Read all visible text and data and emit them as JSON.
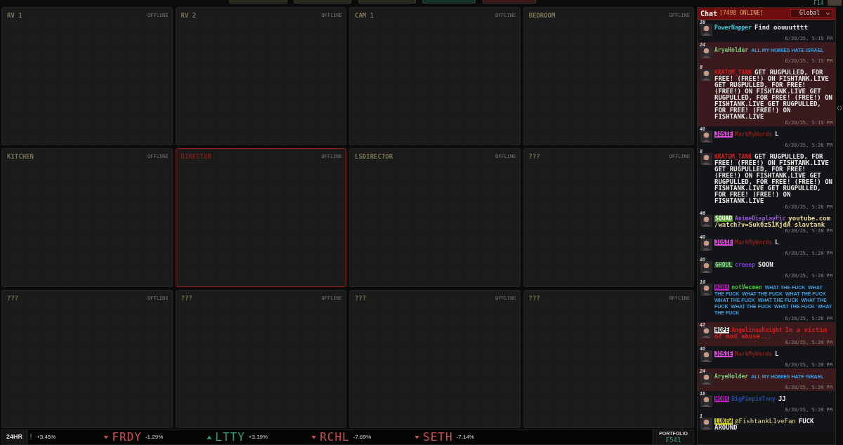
{
  "top_buttons": [
    {
      "color": "#2a271c"
    },
    {
      "color": "#2a271c"
    },
    {
      "color": "#2a271c"
    },
    {
      "color": "#16302c"
    },
    {
      "color": "#3a1616"
    }
  ],
  "account": {
    "balance": "₣14"
  },
  "cameras": [
    {
      "name": "RV 1",
      "status": "OFFLINE",
      "selected": false
    },
    {
      "name": "RV 2",
      "status": "OFFLINE",
      "selected": false
    },
    {
      "name": "CAM 1",
      "status": "OFFLINE",
      "selected": false
    },
    {
      "name": "BEDROOM",
      "status": "OFFLINE",
      "selected": false
    },
    {
      "name": "KITCHEN",
      "status": "OFFLINE",
      "selected": false
    },
    {
      "name": "DIRECTOR",
      "status": "OFFLINE",
      "selected": true
    },
    {
      "name": "LSDIRECTOR",
      "status": "OFFLINE",
      "selected": false
    },
    {
      "name": "???",
      "status": "OFFLINE",
      "selected": false
    },
    {
      "name": "???",
      "status": "OFFLINE",
      "selected": false
    },
    {
      "name": "???",
      "status": "OFFLINE",
      "selected": false
    },
    {
      "name": "???",
      "status": "OFFLINE",
      "selected": false
    },
    {
      "name": "???",
      "status": "OFFLINE",
      "selected": false
    }
  ],
  "chat": {
    "title": "Chat",
    "online": "[7498 ONLINE]",
    "room": "Global",
    "messages": [
      {
        "level": "39",
        "user": {
          "name": "PowerNapper",
          "color": "#3fc8d8"
        },
        "message": {
          "text": "Find oouuutttt",
          "color": "#e8e8e8"
        },
        "kind": "plain",
        "time": "6/28/25, 5:19 PM",
        "highlighted": false
      },
      {
        "level": "24",
        "user": {
          "name": "AryeHolder",
          "color": "#7fc87f"
        },
        "message": {
          "text": "ALL MY HOMIES HATE ISRAEL",
          "color": "#3a9ee0"
        },
        "kind": "small",
        "time": "6/28/25, 5:19 PM",
        "highlighted": true
      },
      {
        "level": "8",
        "user": {
          "name": "KRATOM_TANK",
          "color": "#d02020"
        },
        "message": {
          "text": "GET RUGPULLED, FOR FREE! (FREE!) ON FISHTANK.LIVE GET RUGPULLED, FOR FREE! (FREE!) ON FISHTANK.LIVE GET RUGPULLED, FOR FREE! (FREE!) ON FISHTANK.LIVE GET RUGPULLED, FOR FREE! (FREE!) ON FISHTANK.LIVE",
          "color": "#e8e8e8"
        },
        "kind": "plain",
        "time": "6/28/25, 5:19 PM",
        "highlighted": true
      },
      {
        "level": "40",
        "tag": {
          "text": "JOSIE",
          "color": "#d84ad8"
        },
        "user": {
          "name": "MarkMyWords",
          "color": "#8a1e1e"
        },
        "message": {
          "text": "L",
          "color": "#e8e8e8"
        },
        "kind": "plain",
        "time": "6/28/25, 5:20 PM",
        "highlighted": false
      },
      {
        "level": "8",
        "user": {
          "name": "KRATOM_TANK",
          "color": "#d02020"
        },
        "message": {
          "text": "GET RUGPULLED, FOR FREE! (FREE!) ON FISHTANK.LIVE GET RUGPULLED, FOR FREE! (FREE!) ON FISHTANK.LIVE GET RUGPULLED, FOR FREE! (FREE!) ON FISHTANK.LIVE GET RUGPULLED, FOR FREE! (FREE!) ON FISHTANK.LIVE",
          "color": "#e8e8e8"
        },
        "kind": "plain",
        "time": "6/28/25, 5:20 PM",
        "highlighted": false
      },
      {
        "level": "46",
        "tag": {
          "text": "SQUAD",
          "color": "#4a9a22"
        },
        "user": {
          "name": "AnimeDisplayPic",
          "color": "#9a5ae0"
        },
        "message": {
          "text": "youtube.com/watch?v=Suk6zS1KjdA slavtank",
          "color": "#e8d890"
        },
        "kind": "plain",
        "time": "6/28/25, 5:20 PM",
        "highlighted": false
      },
      {
        "level": "40",
        "tag": {
          "text": "JOSIE",
          "color": "#d84ad8"
        },
        "user": {
          "name": "MarkMyWords",
          "color": "#8a1e1e"
        },
        "message": {
          "text": "L",
          "color": "#e8e8e8"
        },
        "kind": "plain",
        "time": "6/28/25, 5:20 PM",
        "highlighted": false
      },
      {
        "level": "30",
        "tag": {
          "text": "GHOUL",
          "color": "#1e4a1e"
        },
        "user": {
          "name": "creeep",
          "color": "#7a3ae0"
        },
        "message": {
          "text": "SOON",
          "color": "#e8e8e8"
        },
        "kind": "plain",
        "time": "6/28/25, 5:20 PM",
        "highlighted": false
      },
      {
        "level": "16",
        "tag": {
          "text": "HONK",
          "color": "#c020c8"
        },
        "user": {
          "name": "notVecmen",
          "color": "#4ac040"
        },
        "message": {
          "text": "WHAT THE FUCK  WHAT THE FUCK  WHAT THE FUCK  WHAT THE FUCK  WHAT THE FUCK  WHAT THE FUCK  WHAT THE FUCK  WHAT THE FUCK  WHAT THE FUCK  WHAT THE FUCK",
          "color": "#3a9ee0"
        },
        "kind": "small",
        "time": "6/28/25, 5:20 PM",
        "highlighted": false
      },
      {
        "level": "42",
        "tag": {
          "text": "HOPE",
          "color": "#f0f0f0"
        },
        "user": {
          "name": "AngelinasKnight",
          "color": "#d02020"
        },
        "message": {
          "text": "Im a victim of mod abuse...",
          "color": "#d02020"
        },
        "kind": "plain",
        "time": "6/28/25, 5:20 PM",
        "highlighted": true
      },
      {
        "level": "40",
        "tag": {
          "text": "JOSIE",
          "color": "#d84ad8"
        },
        "user": {
          "name": "MarkMyWords",
          "color": "#8a1e1e"
        },
        "message": {
          "text": "L",
          "color": "#e8e8e8"
        },
        "kind": "plain",
        "time": "6/28/25, 5:20 PM",
        "highlighted": false
      },
      {
        "level": "24",
        "user": {
          "name": "AryeHolder",
          "color": "#7fc87f"
        },
        "message": {
          "text": "ALL MY HOMIES HATE ISRAEL",
          "color": "#3a9ee0"
        },
        "kind": "small",
        "time": "6/28/25, 5:20 PM",
        "highlighted": true
      },
      {
        "level": "18",
        "tag": {
          "text": "HONK",
          "color": "#c020c8"
        },
        "user": {
          "name": "BigPimpinTony",
          "color": "#2a4aa0"
        },
        "message": {
          "text": "JJ",
          "color": "#e8e8e8"
        },
        "kind": "plain",
        "time": "6/28/25, 5:20 PM",
        "highlighted": false
      },
      {
        "level": "1",
        "tag": {
          "text": "LUKEW",
          "color": "#d8d020"
        },
        "mention": "@FishtankL1veFan",
        "message": {
          "text": "FUCK AROUND",
          "color": "#e8e8e8"
        },
        "kind": "plain",
        "highlighted": false
      }
    ]
  },
  "ticker": {
    "label": "24HR",
    "items": [
      {
        "symbol": "!",
        "change": "+3.45%",
        "rising": true,
        "clipped": true
      },
      {
        "symbol": "FRDY",
        "change": "-1.29%",
        "rising": false,
        "clipped": false
      },
      {
        "symbol": "LTTY",
        "change": "+3.19%",
        "rising": true,
        "clipped": false
      },
      {
        "symbol": "RCHL",
        "change": "-7.69%",
        "rising": false,
        "clipped": false
      },
      {
        "symbol": "SETH",
        "change": "-7.14%",
        "rising": false,
        "clipped": false
      }
    ]
  },
  "portfolio": {
    "label": "PORTFOLIO",
    "value": "₣541"
  }
}
